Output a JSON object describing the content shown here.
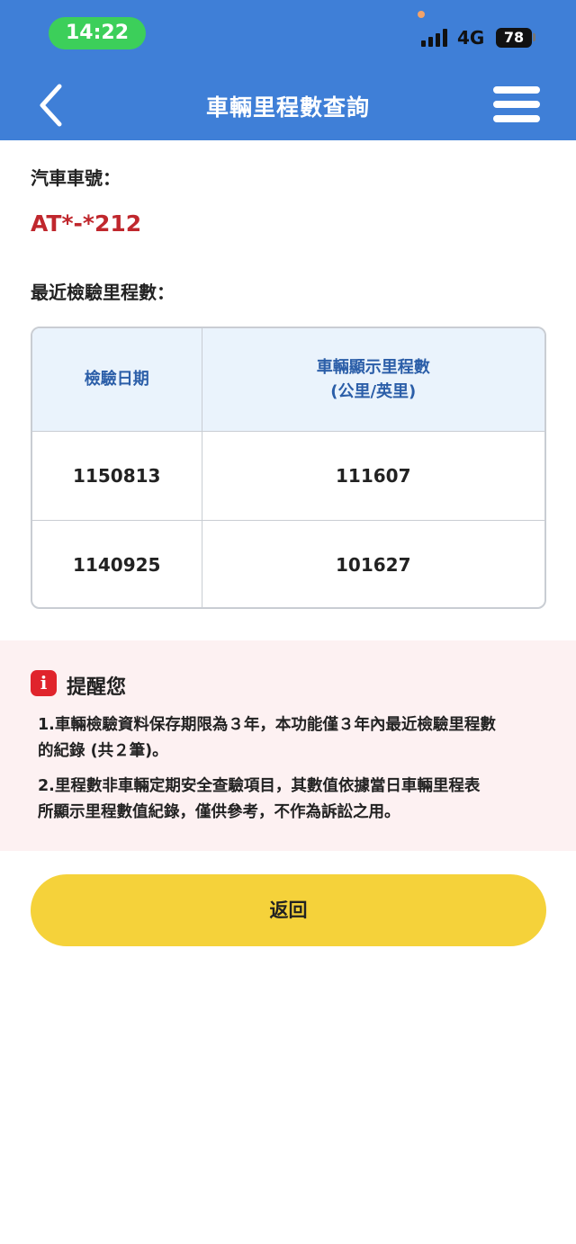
{
  "status_bar": {
    "time": "14:22",
    "network": "4G",
    "battery": "78",
    "colors": {
      "time_pill": "#3ccf5a",
      "battery": "#111111"
    },
    "icons": [
      "signal-bars-icon",
      "battery-icon"
    ]
  },
  "nav": {
    "title": "車輛里程數查詢",
    "back_icon": "chevron-left-icon",
    "menu_icon": "hamburger-menu-icon",
    "background": "#3f7fd7"
  },
  "vehicle": {
    "plate_label": "汽車車號：",
    "plate_number": "AT*-*212",
    "plate_color": "#c0272d"
  },
  "mileage": {
    "section_label": "最近檢驗里程數：",
    "columns": [
      "檢驗日期",
      "車輛顯示里程數",
      "(公里/英里)"
    ],
    "rows": [
      {
        "date": "1150813",
        "mileage": "111607"
      },
      {
        "date": "1140925",
        "mileage": "101627"
      }
    ]
  },
  "notice": {
    "icon": "info-icon",
    "icon_glyph": "i",
    "title": "提醒您",
    "item1_line1": "1.車輛檢驗資料保存期限為３年，本功能僅３年內最近檢驗里程數",
    "item1_line2": "的紀錄 (共２筆)。",
    "item2_line1": "2.里程數非車輛定期安全查驗項目，其數值依據當日車輛里程表",
    "item2_line2": "所顯示里程數值紀錄，僅供參考，不作為訴訟之用。",
    "background": "#fdf1f2"
  },
  "actions": {
    "return_label": "返回",
    "return_color": "#f5d23a"
  }
}
